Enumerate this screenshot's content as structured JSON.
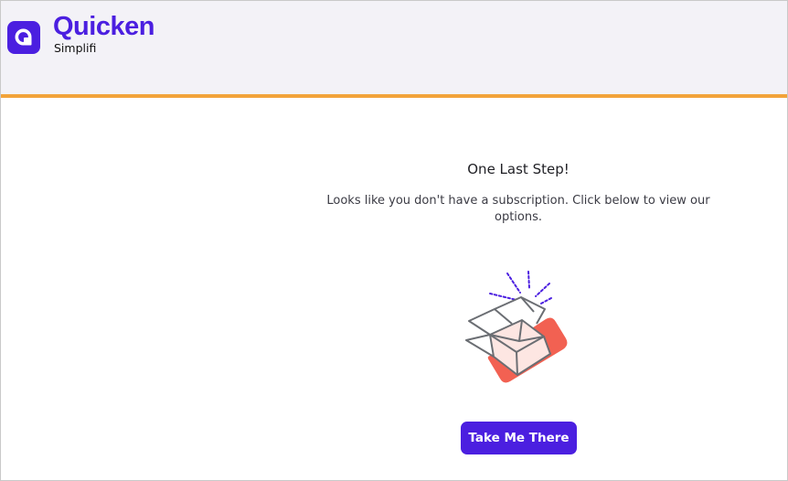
{
  "header": {
    "brand_name": "Quicken",
    "brand_sub": "Simplifi",
    "logo_icon": "quicken-q-icon",
    "accent_color": "#4b1fe0",
    "divider_color": "#f2a33a"
  },
  "main": {
    "title": "One Last Step!",
    "message": "Looks like you don't have a subscription. Click below to view our options.",
    "illustration_icon": "open-box-icon",
    "cta_label": "Take Me There",
    "cta_color": "#4b1fe0"
  }
}
